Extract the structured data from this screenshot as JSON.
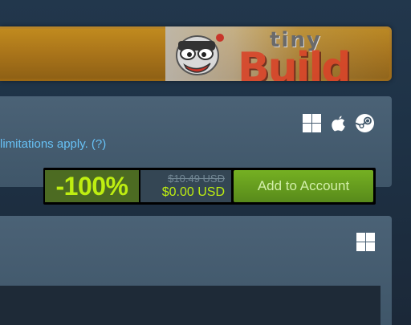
{
  "banner": {
    "logo_top": "tiny",
    "logo_bottom": "Build"
  },
  "platforms": {
    "icons": [
      "windows-icon",
      "apple-icon",
      "steam-icon"
    ]
  },
  "offer": {
    "limitations_text": "limitations apply. (?)",
    "discount": "-100%",
    "original_price": "$10.49 USD",
    "final_price": "$0.00 USD",
    "add_button_label": "Add to Account"
  },
  "second_panel": {
    "platform_icons": [
      "windows-icon"
    ]
  },
  "colors": {
    "accent_green": "#beee11",
    "link_blue": "#67c1f5",
    "button_green": "#75b022",
    "background": "#1b2838"
  }
}
